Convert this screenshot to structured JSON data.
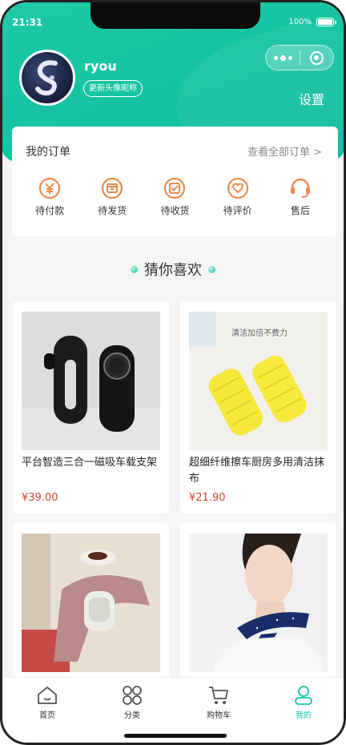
{
  "status_bar": {
    "time": "21:31",
    "battery": "100%"
  },
  "profile": {
    "username": "ryou",
    "update_button": "更新头像昵称",
    "settings": "设置"
  },
  "orders": {
    "title": "我的订单",
    "view_all": "查看全部订单 >",
    "items": [
      {
        "label": "待付款",
        "icon": "yen-circle-icon"
      },
      {
        "label": "待发货",
        "icon": "package-icon"
      },
      {
        "label": "待收货",
        "icon": "check-box-icon"
      },
      {
        "label": "待评价",
        "icon": "heart-bubble-icon"
      },
      {
        "label": "售后",
        "icon": "headset-icon"
      }
    ]
  },
  "guess": {
    "title": "猜你喜欢"
  },
  "products": [
    {
      "name": "平台智造三合一磁吸车载支架",
      "price": "¥39.00"
    },
    {
      "name": "超细纤维擦车厨房多用清洁抹布",
      "price": "¥21.90",
      "image_caption": "清洁加倍不费力"
    },
    {
      "name": "",
      "price": ""
    },
    {
      "name": "",
      "price": ""
    }
  ],
  "tabbar": [
    {
      "label": "首页",
      "icon": "home-icon"
    },
    {
      "label": "分类",
      "icon": "category-icon"
    },
    {
      "label": "购物车",
      "icon": "cart-icon"
    },
    {
      "label": "我的",
      "icon": "user-icon"
    }
  ],
  "colors": {
    "brand": "#14c2a0",
    "price": "#d0422b",
    "order_icon": "#ee8a4a"
  }
}
